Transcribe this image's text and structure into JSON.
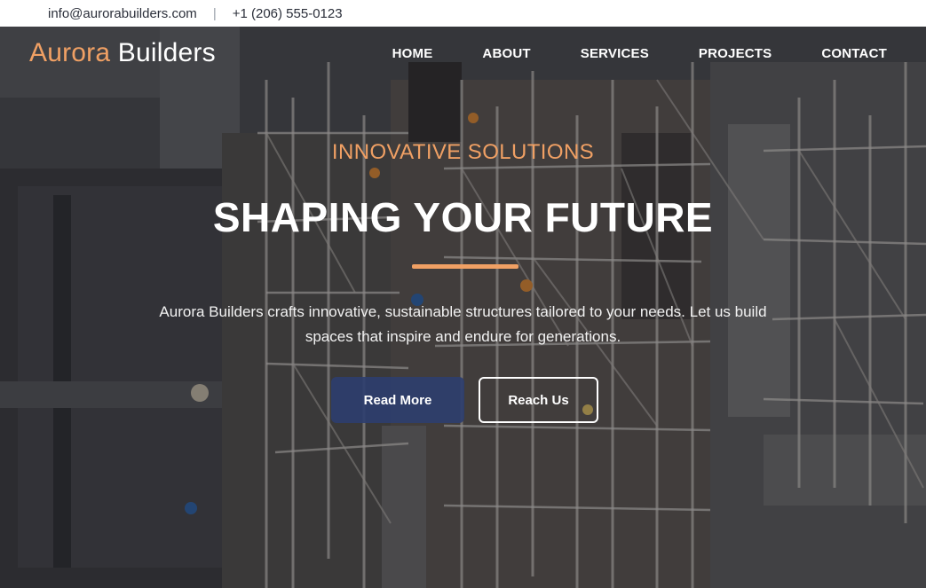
{
  "topbar": {
    "email": "info@aurorabuilders.com",
    "separator": "|",
    "phone": "+1 (206) 555-0123"
  },
  "brand": {
    "first": "Aurora",
    "second": "Builders"
  },
  "nav": {
    "items": [
      "HOME",
      "ABOUT",
      "SERVICES",
      "PROJECTS",
      "CONTACT"
    ]
  },
  "hero": {
    "eyebrow": "INNOVATIVE SOLUTIONS",
    "headline": "SHAPING YOUR FUTURE",
    "description": "Aurora Builders crafts innovative, sustainable structures tailored to your needs. Let us build spaces that inspire and endure for generations.",
    "primary_button": "Read More",
    "secondary_button": "Reach Us",
    "background_image": "aerial construction site photo"
  },
  "colors": {
    "accent": "#f0a064",
    "primary_button": "#2e3e6e",
    "text": "#ffffff"
  }
}
